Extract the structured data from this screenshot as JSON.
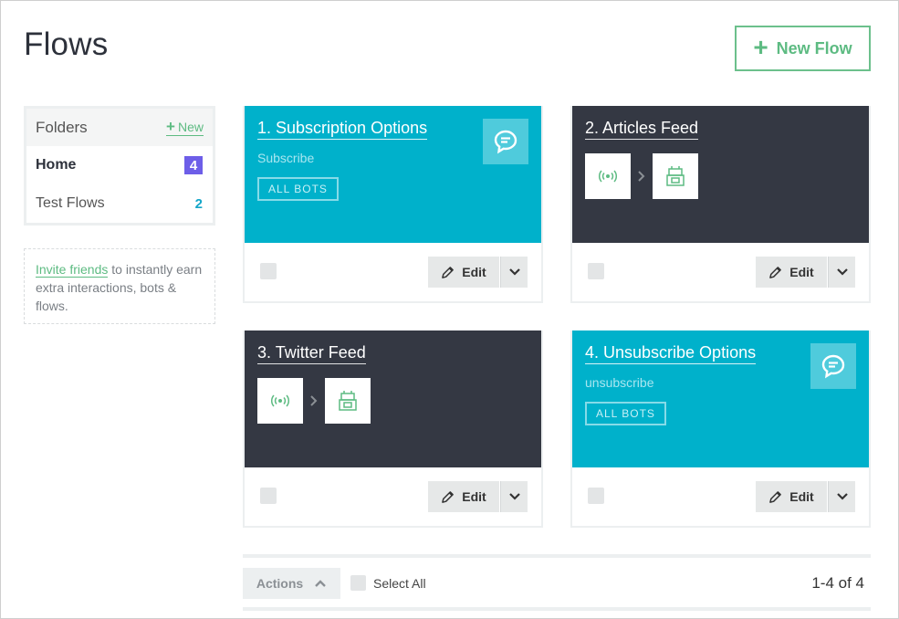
{
  "header": {
    "title": "Flows",
    "new_flow_label": "New Flow"
  },
  "folders": {
    "title": "Folders",
    "new_label": "New",
    "items": [
      {
        "label": "Home",
        "count": "4",
        "active": true
      },
      {
        "label": "Test Flows",
        "count": "2",
        "active": false
      }
    ]
  },
  "invite": {
    "link_text": "Invite friends",
    "rest_text": " to instantly earn extra interactions, bots & flows."
  },
  "cards": [
    {
      "title": "1. Subscription Options",
      "subtitle": "Subscribe",
      "tag": "ALL BOTS",
      "variant": "teal",
      "icon": "chat-bubble-icon"
    },
    {
      "title": "2. Articles Feed",
      "variant": "dark",
      "nodes": [
        "broadcast-icon",
        "robot-icon"
      ]
    },
    {
      "title": "3. Twitter Feed",
      "variant": "dark",
      "nodes": [
        "broadcast-icon",
        "robot-icon"
      ]
    },
    {
      "title": "4. Unsubscribe Options",
      "subtitle": "unsubscribe",
      "tag": "ALL BOTS",
      "variant": "teal",
      "icon": "chat-bubble-icon"
    }
  ],
  "card_edit_label": "Edit",
  "footer": {
    "actions_label": "Actions",
    "select_all_label": "Select All",
    "pagination": "1-4 of 4"
  },
  "colors": {
    "accent_green": "#5dbb82",
    "teal": "#00b1cb",
    "dark": "#343843",
    "badge_purple": "#6d5ee8",
    "count_blue": "#14a6c9"
  }
}
